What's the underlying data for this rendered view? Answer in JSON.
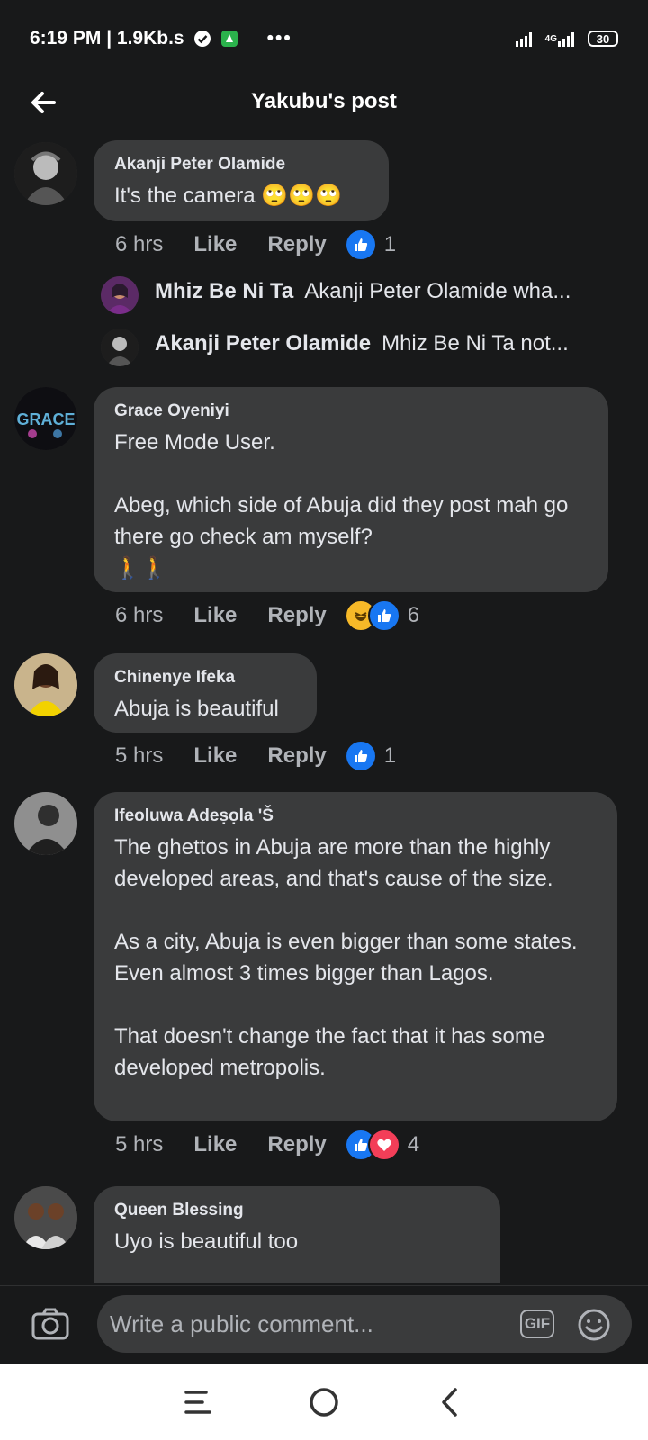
{
  "status_bar": {
    "time_speed": "6:19 PM | 1.9Kb.s",
    "dots": "•••",
    "battery": "30",
    "network": "4G"
  },
  "header": {
    "title": "Yakubu's post"
  },
  "comments": [
    {
      "author": "Akanji Peter Olamide",
      "text": "It's the camera 🙄🙄🙄",
      "time": "6 hrs",
      "like_label": "Like",
      "reply_label": "Reply",
      "reaction_count": "1"
    },
    {
      "author": "Grace Oyeniyi",
      "text": "Free Mode User.\n\nAbeg, which side of Abuja did they post mah go there go check am myself?\n🚶🚶",
      "time": "6 hrs",
      "like_label": "Like",
      "reply_label": "Reply",
      "reaction_count": "6"
    },
    {
      "author": "Chinenye Ifeka",
      "text": "Abuja is beautiful",
      "time": "5 hrs",
      "like_label": "Like",
      "reply_label": "Reply",
      "reaction_count": "1"
    },
    {
      "author": "Ifeoluwa Adeṣọla 'Š",
      "text": "The ghettos in Abuja are more than the highly developed areas, and that's cause of the size.\n\nAs a city, Abuja is even bigger than some states.\nEven almost 3 times bigger than Lagos.\n\nThat doesn't change the fact that it has some developed metropolis.",
      "time": "5 hrs",
      "like_label": "Like",
      "reply_label": "Reply",
      "reaction_count": "4"
    },
    {
      "author": "Queen Blessing",
      "text": "Uyo is beautiful too"
    }
  ],
  "replies": [
    {
      "author": "Mhiz Be Ni Ta",
      "text": "Akanji Peter Olamide wha..."
    },
    {
      "author": "Akanji Peter Olamide",
      "text": "Mhiz Be Ni Ta  not..."
    }
  ],
  "composer": {
    "placeholder": "Write a public comment...",
    "gif_label": "GIF"
  },
  "colors": {
    "background": "#18191a",
    "bubble": "#3a3b3c",
    "like_blue": "#1877f2",
    "love_red": "#f33e58",
    "haha_yellow": "#f7b928"
  }
}
